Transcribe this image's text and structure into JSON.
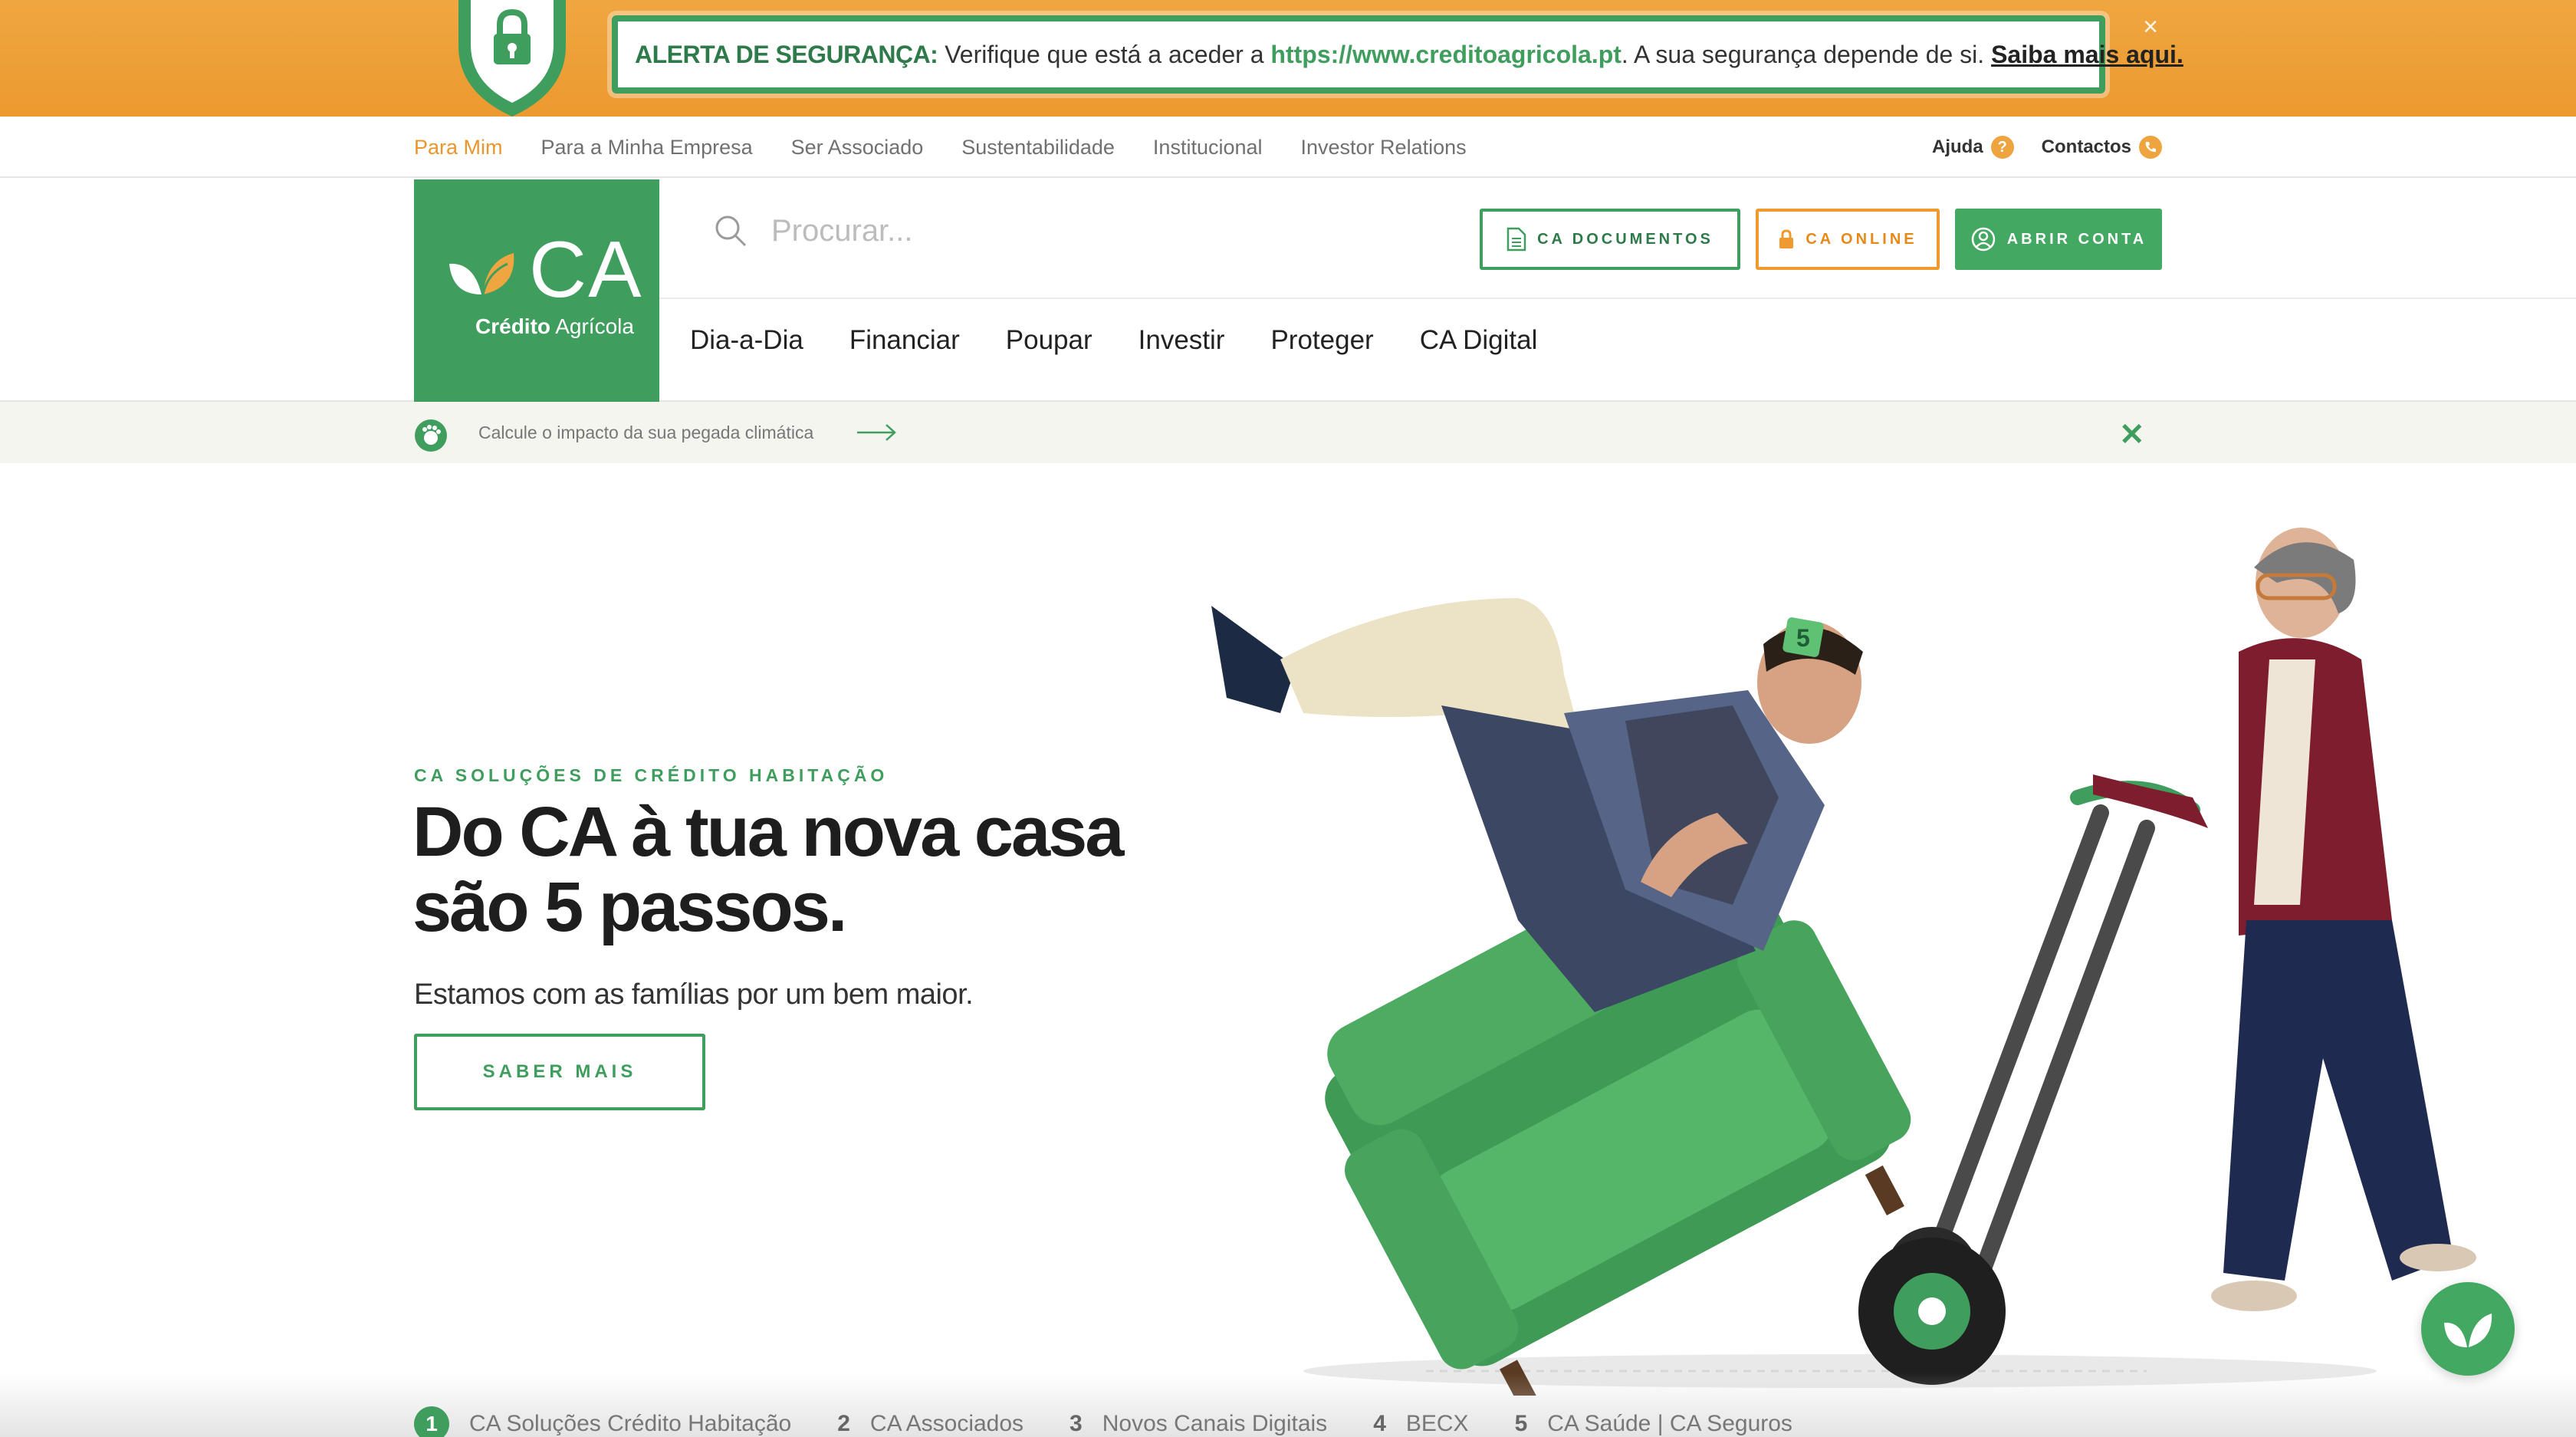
{
  "alert": {
    "title": "ALERTA DE SEGURANÇA:",
    "text_before": " Verifique que está a aceder a ",
    "url": "https://www.creditoagricola.pt",
    "text_after": ". A sua segurança depende de si. ",
    "link": "Saiba mais aqui.",
    "close": "×",
    "icon": "lock-shield-icon",
    "colors": {
      "bar": "#eb9a2f",
      "frame": "#3f9e5e"
    }
  },
  "top_nav": {
    "links": [
      "Para Mim",
      "Para a Minha Empresa",
      "Ser Associado",
      "Sustentabilidade",
      "Institucional",
      "Investor Relations"
    ],
    "active": "Para Mim",
    "help": "Ajuda",
    "help_icon": "?",
    "contacts": "Contactos"
  },
  "logo": {
    "ca": "CA",
    "brand_bold": "Crédito",
    "brand_rest": " Agrícola",
    "color": "#3f9e5e"
  },
  "search": {
    "placeholder": "Procurar..."
  },
  "buttons": {
    "documents": "CA DOCUMENTOS",
    "online": "CA ONLINE",
    "open_account": "ABRIR CONTA"
  },
  "main_menu": [
    "Dia-a-Dia",
    "Financiar",
    "Poupar",
    "Investir",
    "Proteger",
    "CA Digital"
  ],
  "climate": {
    "text": "Calcule o impacto da sua pegada climática",
    "close": "✕"
  },
  "hero": {
    "eyebrow": "CA SOLUÇÕES DE CRÉDITO HABITAÇÃO",
    "title_line1": "Do CA à tua nova casa",
    "title_line2": "são 5 passos.",
    "subtitle": "Estamos com as famílias por um bem maior.",
    "cta": "SABER MAIS",
    "badge": "5"
  },
  "steps": [
    {
      "num": "1",
      "label": "CA Soluções Crédito Habitação"
    },
    {
      "num": "2",
      "label": "CA Associados"
    },
    {
      "num": "3",
      "label": "Novos Canais Digitais"
    },
    {
      "num": "4",
      "label": "BECX"
    },
    {
      "num": "5",
      "label": "CA Saúde | CA Seguros"
    }
  ]
}
